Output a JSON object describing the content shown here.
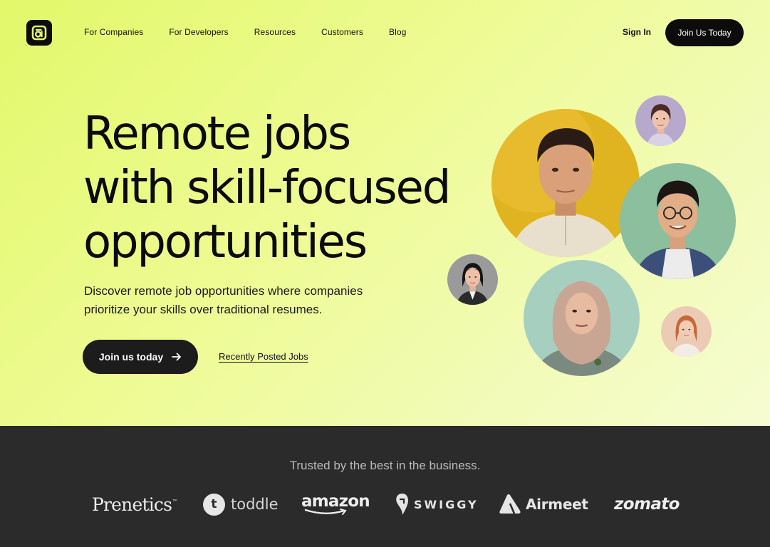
{
  "nav": {
    "links": [
      "For Companies",
      "For Developers",
      "Resources",
      "Customers",
      "Blog"
    ],
    "sign_in": "Sign In",
    "join_button": "Join Us Today"
  },
  "hero": {
    "headline_lines": [
      "Remote jobs",
      "with skill-focused",
      "opportunities"
    ],
    "subtitle": "Discover remote job opportunities where companies prioritize your skills over traditional resumes.",
    "cta_label": "Join us today",
    "secondary_link": "Recently Posted Jobs"
  },
  "trusted": {
    "heading": "Trusted by the best in the business.",
    "brands": [
      "Prenetics",
      "toddle",
      "amazon",
      "SWIGGY",
      "Airmeet",
      "zomato"
    ]
  },
  "colors": {
    "hero_accent": "#e3f86a",
    "dark": "#0c0c0c",
    "footer_bg": "#2b2b2b"
  },
  "icons": [
    "logo-icon",
    "arrow-right-icon"
  ]
}
